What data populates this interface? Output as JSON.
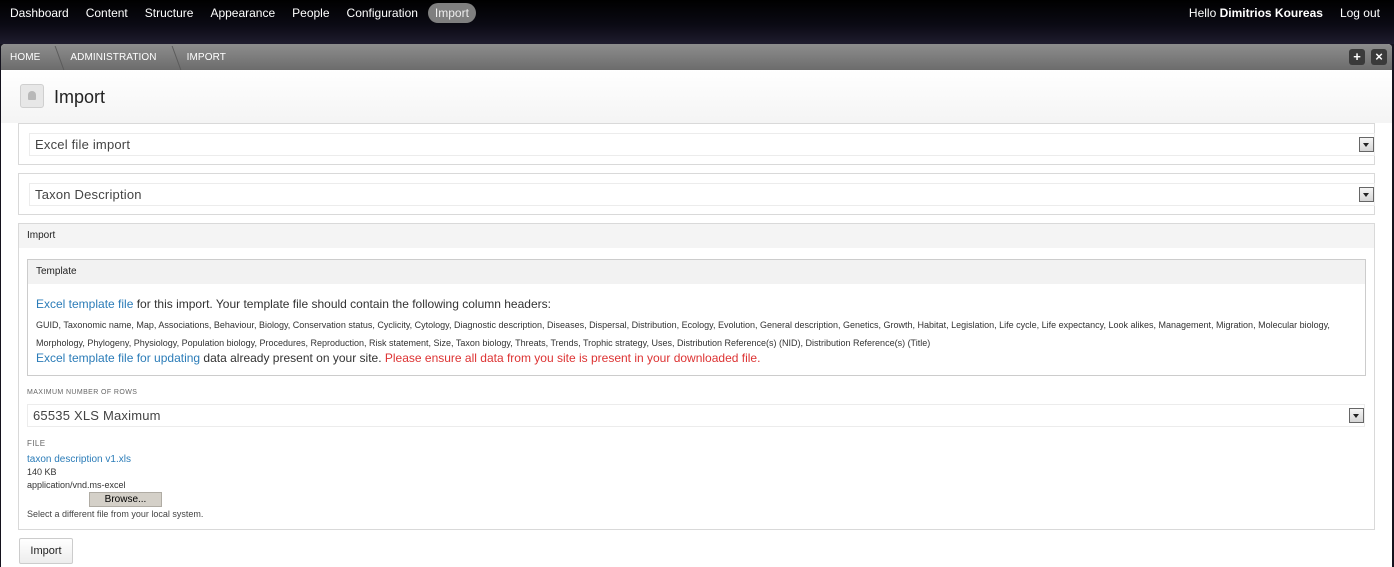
{
  "nav": {
    "items": [
      "Dashboard",
      "Content",
      "Structure",
      "Appearance",
      "People",
      "Configuration",
      "Import"
    ],
    "active": "Import"
  },
  "user": {
    "hello_prefix": "Hello ",
    "name": "Dimitrios Koureas",
    "logout": "Log out"
  },
  "breadcrumb": [
    "HOME",
    "ADMINISTRATION",
    "IMPORT"
  ],
  "toolbar": {
    "add_label": "+",
    "close_label": "×",
    "add_icon": "plus-icon",
    "close_icon": "close-icon"
  },
  "page": {
    "title": "Import",
    "icon": "page-icon"
  },
  "importer_select": {
    "value": "Excel file import"
  },
  "type_select": {
    "value": "Taxon Description"
  },
  "import_fieldset": {
    "legend": "Import",
    "template": {
      "legend": "Template",
      "link1_text": "Excel template file",
      "line1_rest": " for this import. Your template file should contain the following column headers:",
      "columns": "GUID, Taxonomic name, Map, Associations, Behaviour, Biology, Conservation status, Cyclicity, Cytology, Diagnostic description, Diseases, Dispersal, Distribution, Ecology, Evolution, General description, Genetics, Growth, Habitat, Legislation, Life cycle, Life expectancy, Look alikes, Management, Migration, Molecular biology, Morphology, Phylogeny, Physiology, Population biology, Procedures, Reproduction, Risk statement, Size, Taxon biology, Threats, Trends, Trophic strategy, Uses, Distribution Reference(s) (NID), Distribution Reference(s) (Title)",
      "link2_text": "Excel template file for updating",
      "line3_rest": " data already present on your site. ",
      "warning": "Please ensure all data from you site is present in your downloaded file."
    },
    "max_rows": {
      "label": "MAXIMUM NUMBER OF ROWS",
      "value": "65535 XLS Maximum"
    },
    "file": {
      "label": "FILE",
      "name": "taxon description v1.xls",
      "size": "140 KB",
      "mime": "application/vnd.ms-excel",
      "browse_label": "Browse...",
      "help": "Select a different file from your local system."
    }
  },
  "submit": {
    "label": "Import"
  }
}
